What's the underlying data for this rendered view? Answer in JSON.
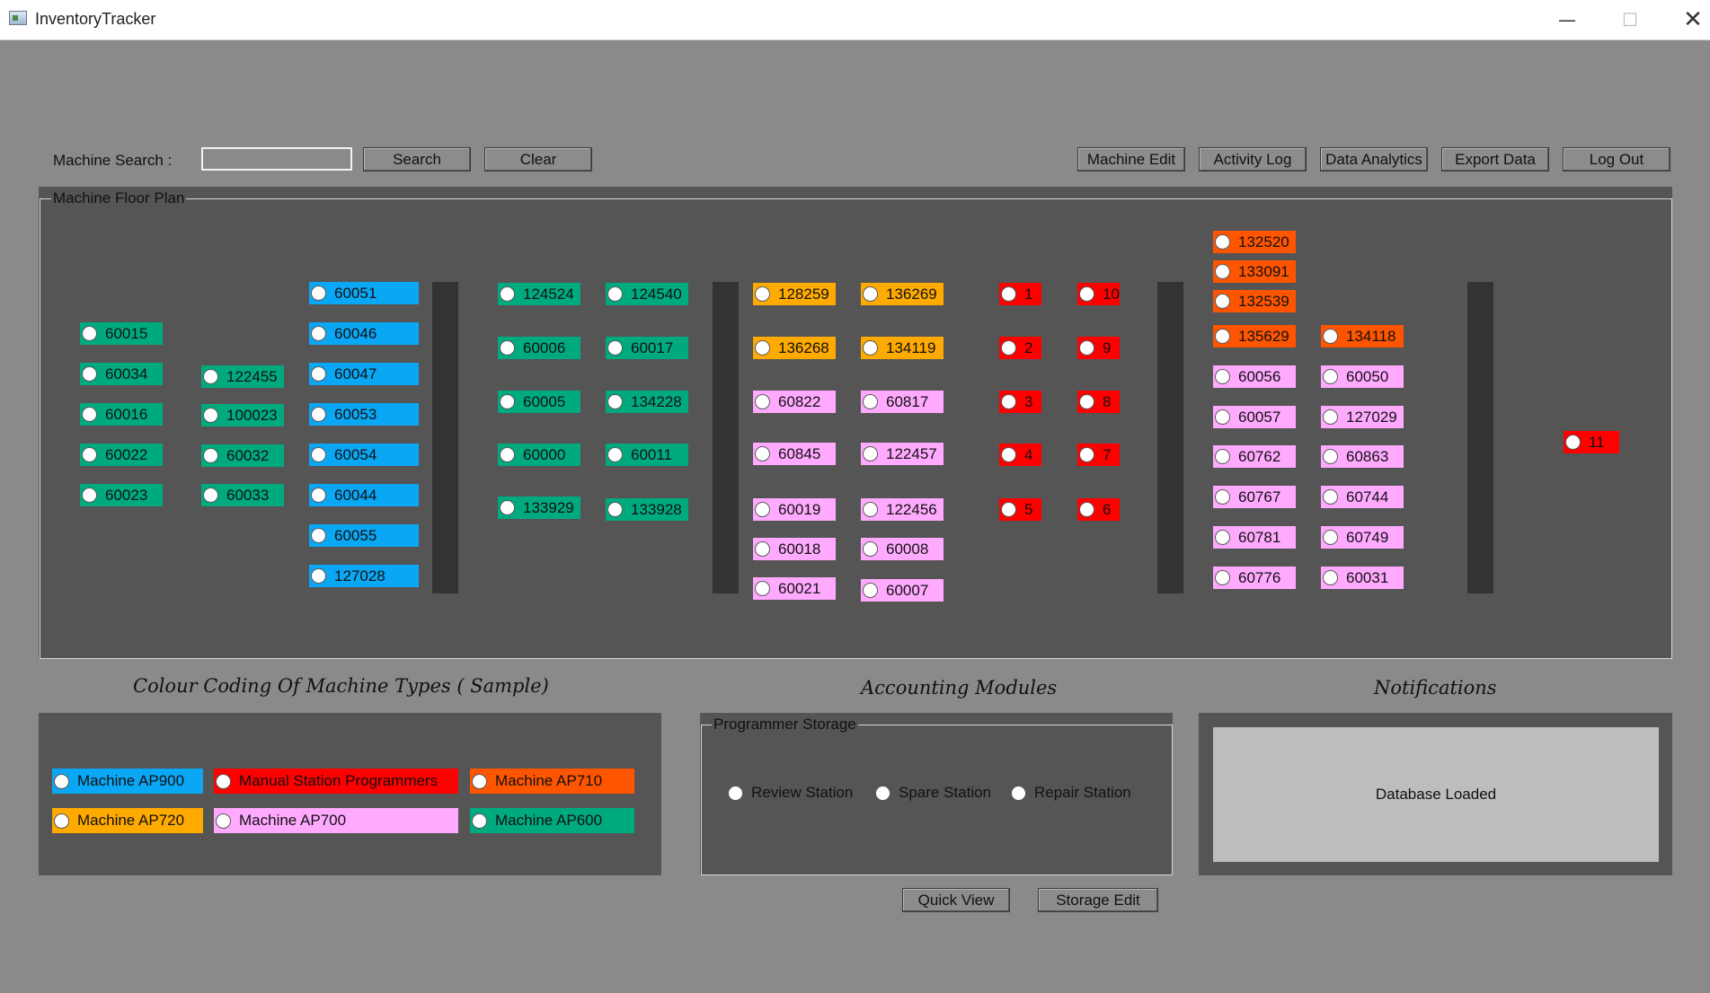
{
  "window": {
    "title": "InventoryTracker",
    "minimize": "—",
    "maximize": "☐",
    "close": "✕"
  },
  "toolbar": {
    "search_label": "Machine Search :",
    "search_value": "",
    "search_button": "Search",
    "clear_button": "Clear",
    "machine_edit": "Machine Edit",
    "activity_log": "Activity Log",
    "data_analytics": "Data Analytics",
    "export_data": "Export Data",
    "log_out": "Log Out"
  },
  "floor_plan": {
    "title": "Machine Floor Plan",
    "machines": [
      {
        "label": "60015",
        "type": "ap600"
      },
      {
        "label": "60034",
        "type": "ap600"
      },
      {
        "label": "60016",
        "type": "ap600"
      },
      {
        "label": "60022",
        "type": "ap600"
      },
      {
        "label": "60023",
        "type": "ap600"
      },
      {
        "label": "122455",
        "type": "ap600"
      },
      {
        "label": "100023",
        "type": "ap600"
      },
      {
        "label": "60032",
        "type": "ap600"
      },
      {
        "label": "60033",
        "type": "ap600"
      },
      {
        "label": "60051",
        "type": "ap900"
      },
      {
        "label": "60046",
        "type": "ap900"
      },
      {
        "label": "60047",
        "type": "ap900"
      },
      {
        "label": "60053",
        "type": "ap900"
      },
      {
        "label": "60054",
        "type": "ap900"
      },
      {
        "label": "60044",
        "type": "ap900"
      },
      {
        "label": "60055",
        "type": "ap900"
      },
      {
        "label": "127028",
        "type": "ap900"
      },
      {
        "label": "124524",
        "type": "ap600"
      },
      {
        "label": "60006",
        "type": "ap600"
      },
      {
        "label": "60005",
        "type": "ap600"
      },
      {
        "label": "60000",
        "type": "ap600"
      },
      {
        "label": "133929",
        "type": "ap600"
      },
      {
        "label": "124540",
        "type": "ap600"
      },
      {
        "label": "60017",
        "type": "ap600"
      },
      {
        "label": "134228",
        "type": "ap600"
      },
      {
        "label": "60011",
        "type": "ap600"
      },
      {
        "label": "133928",
        "type": "ap600"
      },
      {
        "label": "128259",
        "type": "ap720"
      },
      {
        "label": "136268",
        "type": "ap720"
      },
      {
        "label": "60822",
        "type": "ap700"
      },
      {
        "label": "60845",
        "type": "ap700"
      },
      {
        "label": "60019",
        "type": "ap700"
      },
      {
        "label": "60018",
        "type": "ap700"
      },
      {
        "label": "60021",
        "type": "ap700"
      },
      {
        "label": "136269",
        "type": "ap720"
      },
      {
        "label": "134119",
        "type": "ap720"
      },
      {
        "label": "60817",
        "type": "ap700"
      },
      {
        "label": "122457",
        "type": "ap700"
      },
      {
        "label": "122456",
        "type": "ap700"
      },
      {
        "label": "60008",
        "type": "ap700"
      },
      {
        "label": "60007",
        "type": "ap700"
      },
      {
        "label": "1",
        "type": "manual"
      },
      {
        "label": "2",
        "type": "manual"
      },
      {
        "label": "3",
        "type": "manual"
      },
      {
        "label": "4",
        "type": "manual"
      },
      {
        "label": "5",
        "type": "manual"
      },
      {
        "label": "10",
        "type": "manual"
      },
      {
        "label": "9",
        "type": "manual"
      },
      {
        "label": "8",
        "type": "manual"
      },
      {
        "label": "7",
        "type": "manual"
      },
      {
        "label": "6",
        "type": "manual"
      },
      {
        "label": "132520",
        "type": "ap710"
      },
      {
        "label": "133091",
        "type": "ap710"
      },
      {
        "label": "132539",
        "type": "ap710"
      },
      {
        "label": "135629",
        "type": "ap710"
      },
      {
        "label": "60056",
        "type": "ap700"
      },
      {
        "label": "60057",
        "type": "ap700"
      },
      {
        "label": "60762",
        "type": "ap700"
      },
      {
        "label": "60767",
        "type": "ap700"
      },
      {
        "label": "60781",
        "type": "ap700"
      },
      {
        "label": "60776",
        "type": "ap700"
      },
      {
        "label": "134118",
        "type": "ap710"
      },
      {
        "label": "60050",
        "type": "ap700"
      },
      {
        "label": "127029",
        "type": "ap700"
      },
      {
        "label": "60863",
        "type": "ap700"
      },
      {
        "label": "60744",
        "type": "ap700"
      },
      {
        "label": "60749",
        "type": "ap700"
      },
      {
        "label": "60031",
        "type": "ap700"
      },
      {
        "label": "11",
        "type": "manual"
      }
    ]
  },
  "legend": {
    "title": "Colour Coding Of Machine Types ( Sample)",
    "items": [
      {
        "label": "Machine AP900",
        "type": "ap900"
      },
      {
        "label": "Manual Station Programmers",
        "type": "manual"
      },
      {
        "label": "Machine AP710",
        "type": "ap710"
      },
      {
        "label": "Machine AP720",
        "type": "ap720"
      },
      {
        "label": "Machine AP700",
        "type": "ap700"
      },
      {
        "label": "Machine AP600",
        "type": "ap600"
      }
    ]
  },
  "accounting": {
    "title": "Accounting Modules",
    "group_label": "Programmer Storage",
    "options": [
      "Review Station",
      "Spare Station",
      "Repair Station"
    ],
    "quick_view": "Quick View",
    "storage_edit": "Storage Edit"
  },
  "notifications": {
    "title": "Notifications",
    "message": "Database Loaded"
  },
  "colors": {
    "window_bg": "#8a8a8a",
    "panel_bg": "#555555",
    "pillar": "#333333",
    "ap900": "#0aa7f5",
    "ap600": "#00aa7f",
    "ap720": "#ffaa00",
    "ap700": "#ffaaff",
    "manual": "#ff0000",
    "ap710": "#ff5500"
  }
}
